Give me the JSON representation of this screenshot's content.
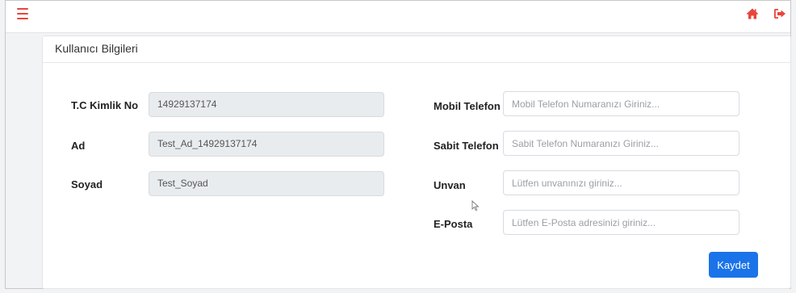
{
  "topbar": {
    "menu_icon": "hamburger-menu-icon",
    "home_icon": "home-icon",
    "logout_icon": "sign-out-icon",
    "accent_color": "#e8453c"
  },
  "card": {
    "title": "Kullanıcı Bilgileri"
  },
  "left_fields": {
    "tc": {
      "label": "T.C Kimlik No",
      "value": "14929137174"
    },
    "ad": {
      "label": "Ad",
      "value": "Test_Ad_14929137174"
    },
    "soyad": {
      "label": "Soyad",
      "value": "Test_Soyad"
    }
  },
  "right_fields": {
    "mobil": {
      "label": "Mobil Telefon",
      "placeholder": "Mobil Telefon Numaranızı Giriniz..."
    },
    "sabit": {
      "label": "Sabit Telefon",
      "placeholder": "Sabit Telefon Numaranızı Giriniz..."
    },
    "unvan": {
      "label": "Unvan",
      "placeholder": "Lütfen unvanınızı giriniz..."
    },
    "eposta": {
      "label": "E-Posta",
      "placeholder": "Lütfen E-Posta adresinizi giriniz..."
    }
  },
  "actions": {
    "save_label": "Kaydet",
    "save_color": "#1a73e8"
  }
}
